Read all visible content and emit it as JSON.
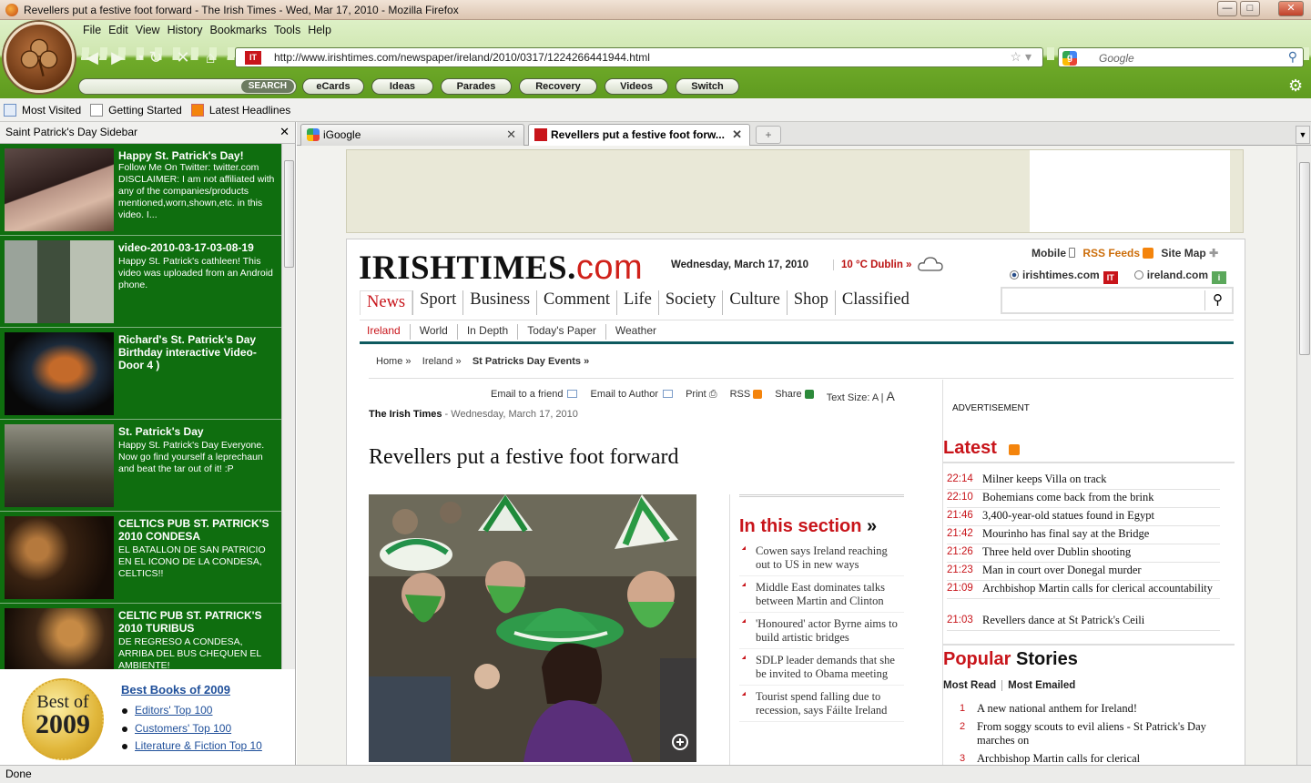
{
  "window": {
    "title": "Revellers put a festive foot forward - The Irish Times - Wed, Mar 17, 2010 - Mozilla Firefox",
    "min": "—",
    "max": "□",
    "close": "✕"
  },
  "menu": [
    "File",
    "Edit",
    "View",
    "History",
    "Bookmarks",
    "Tools",
    "Help"
  ],
  "url": {
    "favicon": "IT",
    "value": "http://www.irishtimes.com/newspaper/ireland/2010/0317/1224266441944.html"
  },
  "search": {
    "placeholder": "Google"
  },
  "toolbar": {
    "search_label": "SEARCH",
    "buttons": [
      "eCards",
      "Ideas",
      "Parades",
      "Recovery",
      "Videos",
      "Switch"
    ]
  },
  "bookmarks": [
    "Most Visited",
    "Getting Started",
    "Latest Headlines"
  ],
  "sidebar": {
    "title": "Saint Patrick's Day Sidebar",
    "close": "✕",
    "videos": [
      {
        "title": "Happy St. Patrick's Day!",
        "desc": "Follow Me On Twitter: twitter.com DISCLAIMER: I am not affiliated with any of the companies/products mentioned,worn,shown,etc. in this video. I..."
      },
      {
        "title": "video-2010-03-17-03-08-19",
        "desc": "Happy St. Patrick's cathleen! This video was uploaded from an Android phone."
      },
      {
        "title": "Richard's St. Patrick's Day Birthday interactive Video-Door 4 )",
        "desc": ""
      },
      {
        "title": "St. Patrick's Day",
        "desc": "Happy St. Patrick's Day Everyone. Now go find yourself a leprechaun and beat the tar out of it! :P"
      },
      {
        "title": "CELTICS PUB ST. PATRICK'S 2010 CONDESA",
        "desc": "EL BATALLON DE SAN PATRICIO EN EL ICONO DE LA CONDESA, CELTICS!!"
      },
      {
        "title": "CELTIC PUB ST. PATRICK'S 2010 TURIBUS",
        "desc": "DE REGRESO A CONDESA, ARRIBA DEL BUS CHEQUEN EL AMBIENTE!"
      }
    ],
    "books": {
      "badge_top": "Best of",
      "badge_year": "2009",
      "heading": "Best Books of 2009",
      "links": [
        "Editors' Top 100",
        "Customers' Top 100",
        "Literature & Fiction Top 10"
      ]
    }
  },
  "tabs": [
    {
      "label": "iGoogle",
      "close": "✕"
    },
    {
      "label": "Revellers put a festive foot forw...",
      "close": "✕"
    }
  ],
  "page": {
    "logo_main": "IRISHTIMES.",
    "logo_com": "com",
    "date": "Wednesday, March 17, 2010",
    "weather": "10 °C Dublin »",
    "top_links": [
      "Mobile",
      "RSS Feeds",
      "Site Map"
    ],
    "radio_options": [
      "irishtimes.com",
      "ireland.com"
    ],
    "nav": [
      "News",
      "Sport",
      "Business",
      "Comment",
      "Life",
      "Society",
      "Culture",
      "Shop",
      "Classified"
    ],
    "subnav": [
      "Ireland",
      "World",
      "In Depth",
      "Today's Paper",
      "Weather"
    ],
    "breadcrumbs": [
      "Home »",
      "Ireland »",
      "St Patricks Day Events »"
    ],
    "tools": [
      "Email to a friend",
      "Email to Author",
      "Print",
      "RSS",
      "Share",
      "Text Size:",
      "A",
      "A"
    ],
    "byline_source": "The Irish Times",
    "byline_date": " - Wednesday, March 17, 2010",
    "headline": "Revellers put a festive foot forward",
    "section": {
      "title": "In this section",
      "arrow": "»",
      "items": [
        "Cowen says Ireland reaching out to US in new ways",
        "Middle East dominates talks between Martin and Clinton",
        "'Honoured' actor Byrne aims to build artistic bridges",
        "SDLP leader demands that she be invited to Obama meeting",
        "Tourist spend falling due to recession, says Fáilte Ireland"
      ]
    },
    "advertisement": "ADVERTISEMENT",
    "latest_title": "Latest",
    "latest": [
      {
        "time": "22:14",
        "headline": "Milner keeps Villa on track"
      },
      {
        "time": "22:10",
        "headline": "Bohemians come back from the brink"
      },
      {
        "time": "21:46",
        "headline": "3,400-year-old statues found in Egypt"
      },
      {
        "time": "21:42",
        "headline": "Mourinho has final say at the Bridge"
      },
      {
        "time": "21:26",
        "headline": "Three held over Dublin shooting"
      },
      {
        "time": "21:23",
        "headline": "Man in court over Donegal murder"
      },
      {
        "time": "21:09",
        "headline": "Archbishop Martin calls for clerical accountability"
      },
      {
        "time": "21:03",
        "headline": "Revellers dance at St Patrick's Ceili"
      }
    ],
    "popular_a": "Popular",
    "popular_b": " Stories",
    "popular_tabs": [
      "Most Read",
      "Most Emailed"
    ],
    "popular": [
      {
        "n": "1",
        "headline": "A new national anthem for Ireland!"
      },
      {
        "n": "2",
        "headline": "From soggy scouts to evil aliens - St Patrick's Day marches on"
      },
      {
        "n": "3",
        "headline": "Archbishop Martin calls for clerical"
      }
    ]
  },
  "status": "Done",
  "colors": {
    "accent_red": "#c8141a",
    "sidebar_green": "#0f6e0f",
    "chrome_green": "#5f9b1f"
  }
}
